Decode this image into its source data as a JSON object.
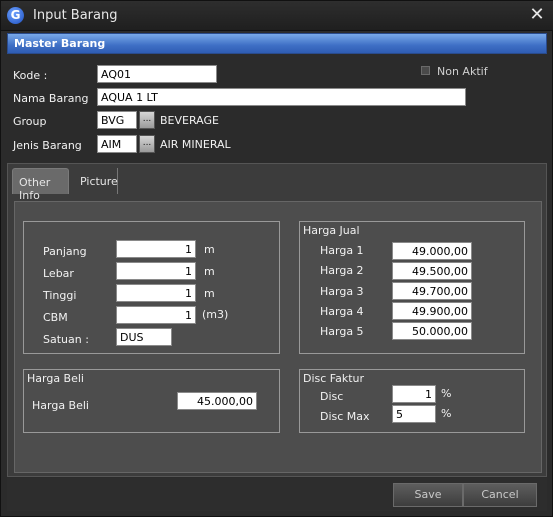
{
  "window": {
    "title": "Input  Barang",
    "app_icon_letter": "G",
    "close_symbol": "✕"
  },
  "master": {
    "header": "Master Barang",
    "kode_label": "Kode :",
    "kode_value": "AQ01",
    "nama_label": "Nama Barang",
    "nama_value": "AQUA 1 LT",
    "group_label": "Group",
    "group_code": "BVG",
    "group_name": "BEVERAGE",
    "jenis_label": "Jenis Barang",
    "jenis_code": "AIM",
    "jenis_name": "AIR MINERAL",
    "lookup_label": "...",
    "non_aktif_label": "Non Aktif",
    "non_aktif_checked": false
  },
  "tabs": [
    {
      "label": "Other Info",
      "active": true
    },
    {
      "label": "Picture",
      "active": false
    }
  ],
  "dimensions": {
    "panjang_label": "Panjang",
    "panjang_value": "1",
    "panjang_unit": "m",
    "lebar_label": "Lebar",
    "lebar_value": "1",
    "lebar_unit": "m",
    "tinggi_label": "Tinggi",
    "tinggi_value": "1",
    "tinggi_unit": "m",
    "cbm_label": "CBM",
    "cbm_value": "1",
    "cbm_unit": "(m3)",
    "satuan_label": "Satuan :",
    "satuan_value": "DUS"
  },
  "harga_jual": {
    "title": "Harga Jual",
    "items": [
      {
        "label": "Harga 1",
        "value": "49.000,00"
      },
      {
        "label": "Harga 2",
        "value": "49.500,00"
      },
      {
        "label": "Harga 3",
        "value": "49.700,00"
      },
      {
        "label": "Harga 4",
        "value": "49.900,00"
      },
      {
        "label": "Harga 5",
        "value": "50.000,00"
      }
    ]
  },
  "harga_beli": {
    "title": "Harga Beli",
    "label": "Harga Beli",
    "value": "45.000,00"
  },
  "disc_faktur": {
    "title": "Disc Faktur",
    "disc_label": "Disc",
    "disc_value": "1",
    "disc_unit": "%",
    "disc_max_label": "Disc Max",
    "disc_max_value": "5",
    "disc_max_unit": "%"
  },
  "footer": {
    "save_label": "Save",
    "cancel_label": "Cancel"
  },
  "colors": {
    "header_accent": "#3e6fc5",
    "window_bg": "#2b2b2b",
    "panel_bg": "#4d4d4d"
  }
}
